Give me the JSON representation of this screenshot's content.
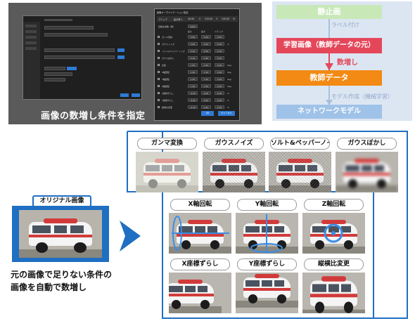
{
  "screenshot": {
    "caption": "画像の数増し条件を指定",
    "main_window": {
      "title": "データセット編集画面",
      "fields": [
        "学習データ",
        "作業フォルダ",
        "元画像フォルダ",
        "教師データ"
      ],
      "run_button": "実行",
      "cancel_button": "閉じる"
    },
    "dialog": {
      "title": "画像オーグメンテーション設定",
      "flip_label": "フリップ",
      "ratio_label": "拡大率 1",
      "ratio_values": [
        "40.00",
        "2",
        "110.00",
        "3",
        "120.00",
        "%"
      ],
      "generate_label": "自動生成数（枚）",
      "generate_value": "2000",
      "columns": [
        "最小",
        "最大",
        "ステップ"
      ],
      "rows": [
        {
          "label": "ガンマ変換",
          "min": "0.50",
          "max": "2.00",
          "step": "0.50",
          "unit": ""
        },
        {
          "label": "ガウスノイズ",
          "min": "0.00",
          "max": "5.00",
          "step": "2.00",
          "unit": "%"
        },
        {
          "label": "ソルト＆ペッパーノイズ",
          "min": "0.10",
          "max": "0.50",
          "step": "0.10",
          "unit": ""
        },
        {
          "label": "ガウスぼかし",
          "min": "0.10",
          "max": "0.40",
          "step": "0.40",
          "unit": ""
        },
        {
          "label": "反転",
          "min": "1.50",
          "max": "1.50",
          "step": "2.00",
          "unit": "deg"
        },
        {
          "label": "X軸回転",
          "min": "1.50",
          "max": "1.50",
          "step": "2.00",
          "unit": "deg"
        },
        {
          "label": "Y軸回転",
          "min": "1.50",
          "max": "1.50",
          "step": "2.00",
          "unit": "deg"
        },
        {
          "label": "Z軸回転",
          "min": "1.50",
          "max": "1.50",
          "step": "2.00",
          "unit": "deg"
        },
        {
          "label": "X座標ずらし",
          "min": "-4.00",
          "max": "4.00",
          "step": "4.00",
          "unit": "%"
        },
        {
          "label": "Y座標ずらし",
          "min": "-4.00",
          "max": "4.00",
          "step": "4.00",
          "unit": "%"
        },
        {
          "label": "縦横比変更",
          "min": "-0.20",
          "max": "0.20",
          "step": "0.20",
          "unit": "%"
        }
      ],
      "ok_button": "OK",
      "cancel_button": "キャンセル"
    }
  },
  "flow": {
    "static_image": "静止画",
    "label_step": "ラベル付け",
    "training_image": "学習画像（教師データの元）",
    "augment_step": "数増し",
    "teacher_data": "教師データ",
    "model_step": "モデル作成（機械学習）",
    "network_model": "ネットワークモデル",
    "colors": {
      "static": "#c8e8b8",
      "training": "#e5475a",
      "teacher": "#f28a14",
      "network": "#9fc2e8",
      "background": "#dce6f2"
    }
  },
  "original": {
    "title": "オリジナル画像",
    "description_line1": "元の画像で足りない条件の",
    "description_line2": "画像を自動で数増し"
  },
  "augmentations": [
    {
      "name": "gamma",
      "label": "ガンマ変換"
    },
    {
      "name": "gauss-noise",
      "label": "ガウスノイズ"
    },
    {
      "name": "salt-pepper",
      "label": "ソルト&ペッパーノイズ"
    },
    {
      "name": "gauss-blur",
      "label": "ガウスぼかし"
    },
    {
      "name": "x-rotation",
      "label": "X軸回転"
    },
    {
      "name": "y-rotation",
      "label": "Y軸回転"
    },
    {
      "name": "z-rotation",
      "label": "Z軸回転"
    },
    {
      "name": "x-shift",
      "label": "X座標ずらし"
    },
    {
      "name": "y-shift",
      "label": "Y座標ずらし"
    },
    {
      "name": "aspect-change",
      "label": "縦横比変更"
    }
  ],
  "accent_color": "#1f6fc2"
}
